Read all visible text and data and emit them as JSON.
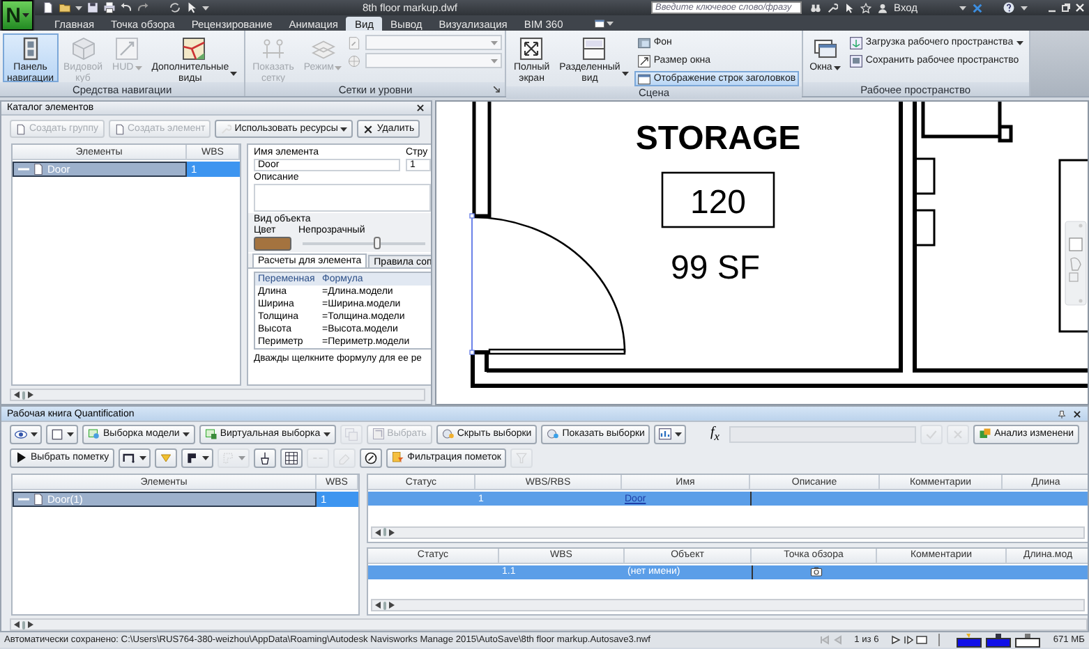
{
  "title_bar": {
    "app_logo": "N",
    "document_title": "8th floor markup.dwf",
    "search": {
      "placeholder": "Введите ключевое слово/фразу"
    },
    "sign_in": "Вход"
  },
  "ribbon_tabs": [
    {
      "label": "Главная",
      "selected": false
    },
    {
      "label": "Точка обзора",
      "selected": false
    },
    {
      "label": "Рецензирование",
      "selected": false
    },
    {
      "label": "Анимация",
      "selected": false
    },
    {
      "label": "Вид",
      "selected": true
    },
    {
      "label": "Вывод",
      "selected": false
    },
    {
      "label": "Визуализация",
      "selected": false
    },
    {
      "label": "BIM 360",
      "selected": false
    }
  ],
  "ribbon_groups": [
    {
      "title": "Средства навигации",
      "launcher": false,
      "items": [
        {
          "kind": "large",
          "label": "Панель\nнавигации",
          "selected": true,
          "disabled": false,
          "dropdown": false
        },
        {
          "kind": "large",
          "label": "Видовой\nкуб",
          "selected": false,
          "disabled": true,
          "dropdown": false
        },
        {
          "kind": "large",
          "label": "HUD",
          "selected": false,
          "disabled": true,
          "dropdown": true
        },
        {
          "kind": "large",
          "label": "Дополнительные\nвиды",
          "selected": false,
          "disabled": false,
          "dropdown": true
        }
      ]
    },
    {
      "title": "Сетки и уровни",
      "launcher": true,
      "items": [
        {
          "kind": "large",
          "label": "Показать\nсетку",
          "selected": false,
          "disabled": true,
          "dropdown": false
        },
        {
          "kind": "large",
          "label": "Режим",
          "selected": false,
          "disabled": true,
          "dropdown": true
        },
        {
          "kind": "stack",
          "rows": [
            {
              "kind": "combo",
              "disabled": true
            },
            {
              "kind": "combo",
              "disabled": true
            }
          ]
        }
      ]
    },
    {
      "title": "Сцена",
      "launcher": false,
      "items": [
        {
          "kind": "large",
          "label": "Полный\nэкран",
          "selected": false,
          "disabled": false,
          "dropdown": false
        },
        {
          "kind": "large",
          "label": "Разделенный\nвид",
          "selected": false,
          "disabled": false,
          "dropdown": true
        },
        {
          "kind": "stack",
          "rows": [
            {
              "kind": "small",
              "label": "Фон",
              "selected": false,
              "dropdown": false
            },
            {
              "kind": "small",
              "label": "Размер окна",
              "selected": false,
              "dropdown": false
            },
            {
              "kind": "small",
              "label": "Отображение строк заголовков",
              "selected": true,
              "dropdown": false
            }
          ]
        }
      ]
    },
    {
      "title": "Рабочее пространство",
      "launcher": false,
      "items": [
        {
          "kind": "large",
          "label": "Окна",
          "selected": false,
          "disabled": false,
          "dropdown": true
        },
        {
          "kind": "stack",
          "rows": [
            {
              "kind": "small",
              "label": "Загрузка рабочего пространства",
              "selected": false,
              "dropdown": true
            },
            {
              "kind": "small",
              "label": "Сохранить рабочее пространство",
              "selected": false,
              "dropdown": false
            }
          ]
        }
      ]
    }
  ],
  "catalog": {
    "title": "Каталог элементов",
    "toolbar": [
      {
        "label": "Создать группу",
        "disabled": true,
        "dropdown": false
      },
      {
        "label": "Создать элемент",
        "disabled": true,
        "dropdown": false
      },
      {
        "label": "Использовать ресурсы",
        "disabled": false,
        "dropdown": true
      },
      {
        "label": "Удалить",
        "disabled": false,
        "dropdown": false
      }
    ],
    "tree": {
      "columns": [
        "Элементы",
        "WBS"
      ],
      "rows": [
        {
          "name": "Door",
          "wbs": "1",
          "selected": true
        }
      ]
    },
    "properties": {
      "name_label": "Имя элемента",
      "name_value": "Door",
      "wbs_label": "Стру",
      "wbs_value": "1",
      "description_label": "Описание",
      "appearance": {
        "title": "Вид объекта",
        "color_label": "Цвет",
        "color": "#a4733f",
        "opacity_label": "Непрозрачный",
        "level": 0.6
      },
      "tabs": [
        {
          "label": "Расчеты для элемента",
          "selected": true
        },
        {
          "label": "Правила соп",
          "selected": false
        }
      ],
      "formulas": {
        "columns": [
          "Переменная",
          "Формула"
        ],
        "rows": [
          {
            "variable": "Длина",
            "formula": "=Длина.модели"
          },
          {
            "variable": "Ширина",
            "formula": "=Ширина.модели"
          },
          {
            "variable": "Толщина",
            "formula": "=Толщина.модели"
          },
          {
            "variable": "Высота",
            "formula": "=Высота.модели"
          },
          {
            "variable": "Периметр",
            "formula": "=Периметр.модели"
          }
        ]
      },
      "hint": "Дважды щелкните формулу для ее ре"
    }
  },
  "canvas": {
    "room_name": "STORAGE",
    "room_number": "120",
    "area": "99 SF"
  },
  "workbook": {
    "title": "Рабочая книга Quantification",
    "toolbar_1": [
      {
        "kind": "icon",
        "disabled": false,
        "dropdown": true
      },
      {
        "kind": "icon",
        "disabled": false,
        "dropdown": true
      },
      {
        "kind": "button",
        "label": "Выборка модели",
        "disabled": false,
        "dropdown": true
      },
      {
        "kind": "button",
        "label": "Виртуальная выборка",
        "disabled": false,
        "dropdown": true
      },
      {
        "kind": "icon",
        "disabled": true,
        "dropdown": false
      },
      {
        "kind": "button",
        "label": "Выбрать",
        "disabled": true,
        "dropdown": false
      },
      {
        "kind": "button",
        "label": "Скрыть выборки",
        "disabled": false,
        "dropdown": false
      },
      {
        "kind": "button",
        "label": "Показать выборки",
        "disabled": false,
        "dropdown": false
      },
      {
        "kind": "icon",
        "disabled": false,
        "dropdown": true
      },
      {
        "kind": "formula",
        "label": "f$_{x}$",
        "disabled": true
      },
      {
        "kind": "icon",
        "disabled": true,
        "dropdown": false
      },
      {
        "kind": "icon",
        "disabled": true,
        "dropdown": false
      },
      {
        "kind": "button",
        "label": "Анализ изменени",
        "disabled": false,
        "dropdown": false
      }
    ],
    "toolbar_2": [
      {
        "kind": "button",
        "label": "Выбрать пометку",
        "disabled": false,
        "dropdown": false
      },
      {
        "kind": "icon",
        "disabled": false,
        "dropdown": true
      },
      {
        "kind": "icon",
        "disabled": false,
        "dropdown": false
      },
      {
        "kind": "icon",
        "disabled": false,
        "dropdown": true
      },
      {
        "kind": "icon",
        "disabled": true,
        "dropdown": true
      },
      {
        "kind": "icon",
        "disabled": false,
        "dropdown": false
      },
      {
        "kind": "icon",
        "disabled": false,
        "dropdown": false
      },
      {
        "kind": "icon",
        "disabled": true,
        "dropdown": false
      },
      {
        "kind": "icon",
        "disabled": true,
        "dropdown": false
      },
      {
        "kind": "icon",
        "disabled": false,
        "dropdown": false
      },
      {
        "kind": "button",
        "label": "Фильтрация пометок",
        "disabled": false,
        "dropdown": false
      },
      {
        "kind": "icon",
        "disabled": true,
        "dropdown": false
      }
    ],
    "tree": {
      "columns": [
        "Элементы",
        "WBS"
      ],
      "rows": [
        {
          "name": "Door(1)",
          "wbs": "1",
          "selected": true
        }
      ]
    },
    "items_table": {
      "columns": [
        "Статус",
        "WBS/RBS",
        "Имя",
        "Описание",
        "Комментарии",
        "Длина"
      ],
      "rows": [
        {
          "wbs_rbs": "1",
          "name": "Door",
          "selected": true
        }
      ]
    },
    "takeoff_table": {
      "columns": [
        "Статус",
        "WBS",
        "Объект",
        "Точка обзора",
        "Комментарии",
        "Длина.мод"
      ],
      "rows": [
        {
          "wbs": "1.1",
          "object": "(нет имени)",
          "viewpoint": true,
          "selected": true
        }
      ]
    }
  },
  "status_bar": {
    "autosave": "Автоматически сохранено: C:\\Users\\RUS764-380-weizhou\\AppData\\Roaming\\Autodesk Navisworks Manage 2015\\AutoSave\\8th floor markup.Autosave3.nwf",
    "page": "1 из 6",
    "memory": "671 МБ"
  }
}
